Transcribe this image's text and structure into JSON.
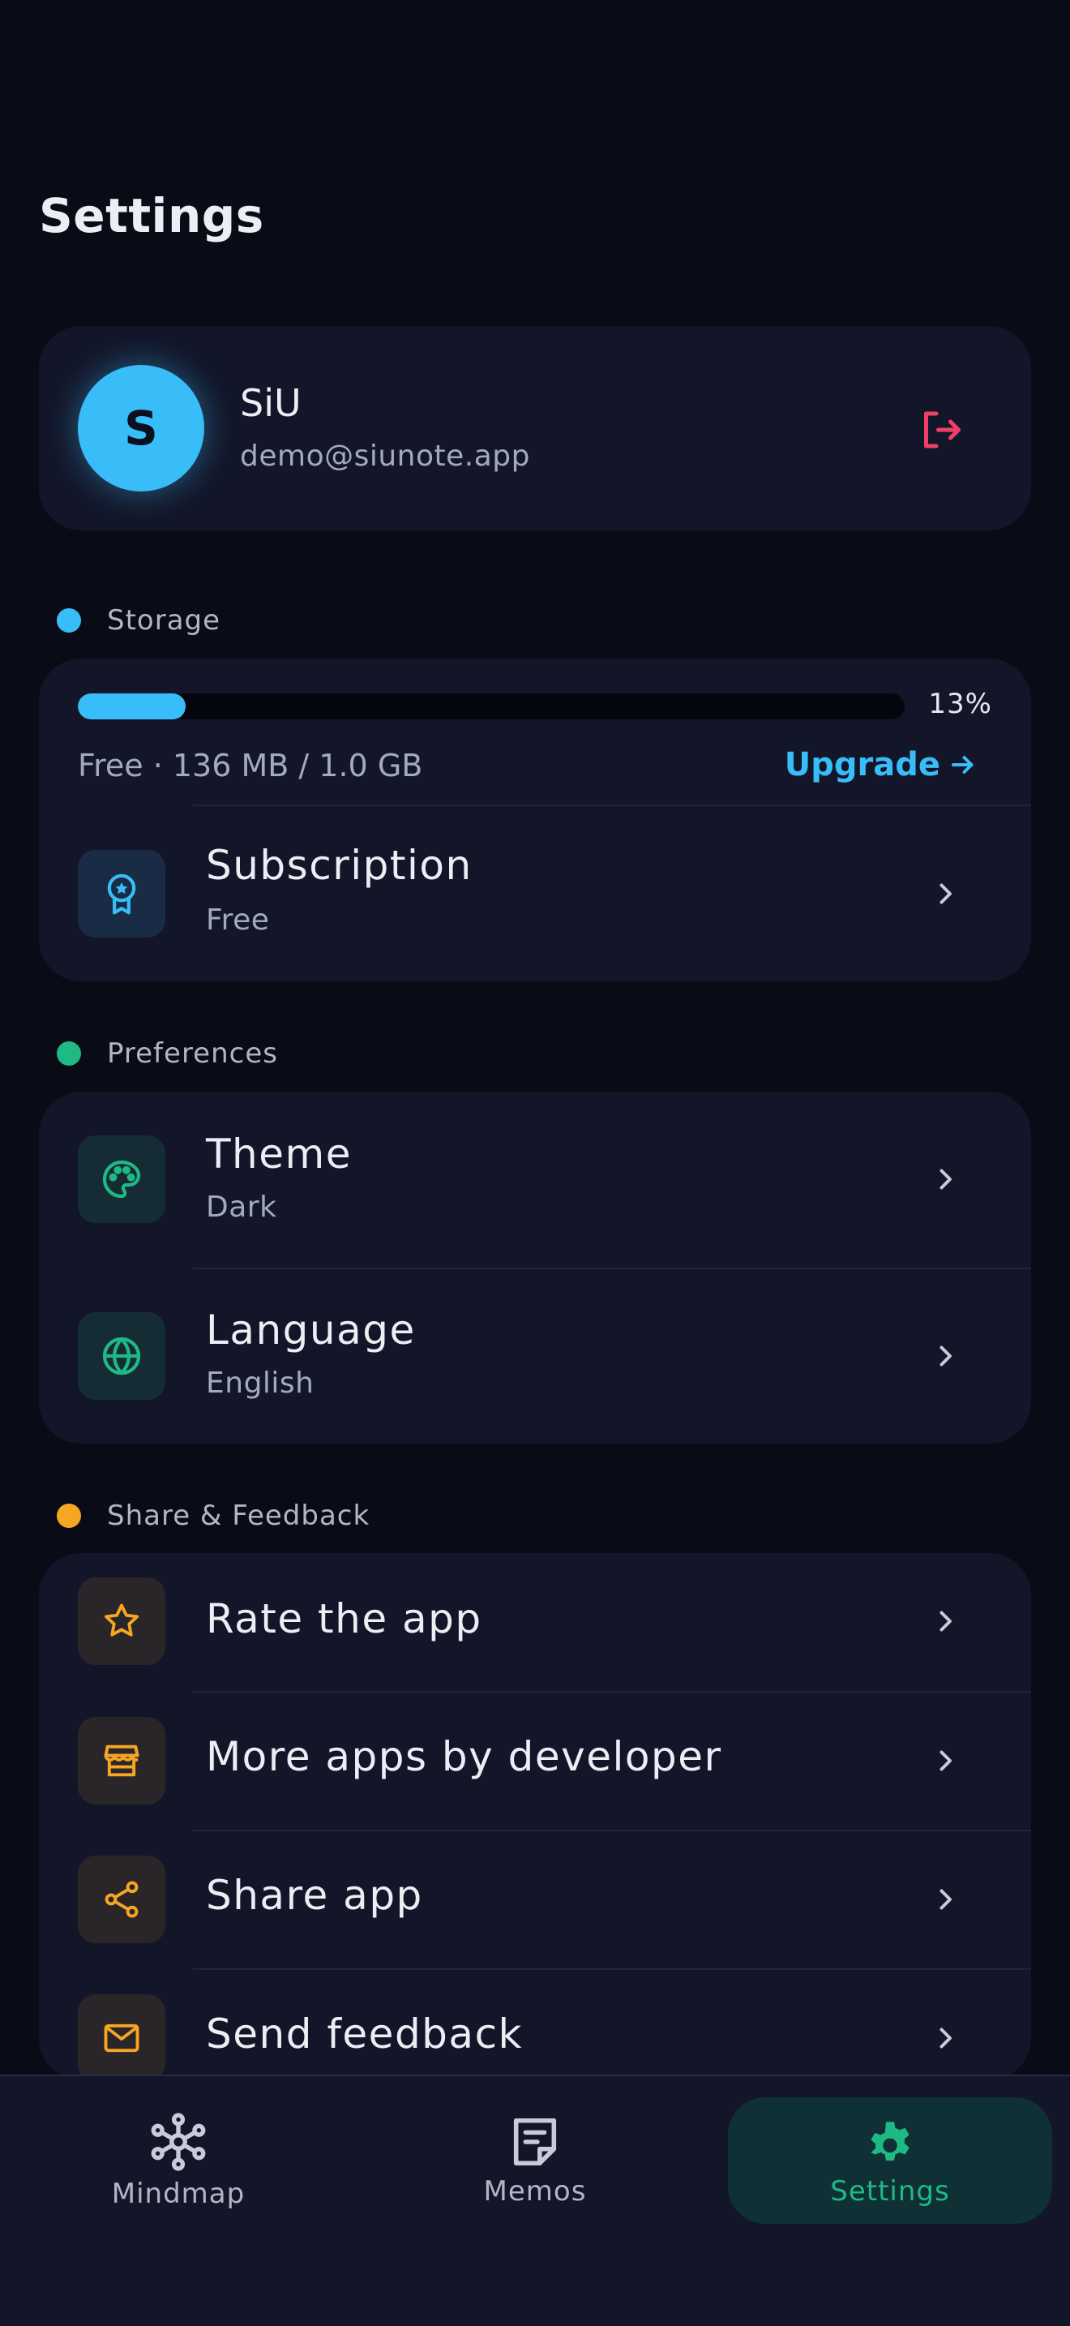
{
  "page": {
    "title": "Settings"
  },
  "profile": {
    "avatar_letter": "S",
    "name": "SiU",
    "email": "demo@siunote.app"
  },
  "storage": {
    "section_label": "Storage",
    "usage_fraction": 0.13,
    "percent_text": "13%",
    "info": "Free · 136 MB / 1.0 GB",
    "upgrade_label": "Upgrade",
    "subscription": {
      "title": "Subscription",
      "value": "Free"
    }
  },
  "preferences": {
    "section_label": "Preferences",
    "theme": {
      "title": "Theme",
      "value": "Dark"
    },
    "language": {
      "title": "Language",
      "value": "English"
    }
  },
  "share": {
    "section_label": "Share & Feedback",
    "items": [
      {
        "title": "Rate the app"
      },
      {
        "title": "More apps by developer"
      },
      {
        "title": "Share app"
      },
      {
        "title": "Send feedback"
      }
    ]
  },
  "nav": {
    "mindmap": "Mindmap",
    "memos": "Memos",
    "settings": "Settings"
  },
  "colors": {
    "accent_blue": "#38bdf8",
    "accent_green": "#1fb985",
    "accent_orange": "#f5a623",
    "logout_red": "#f0406a",
    "background": "#090b16",
    "card": "#131629"
  }
}
